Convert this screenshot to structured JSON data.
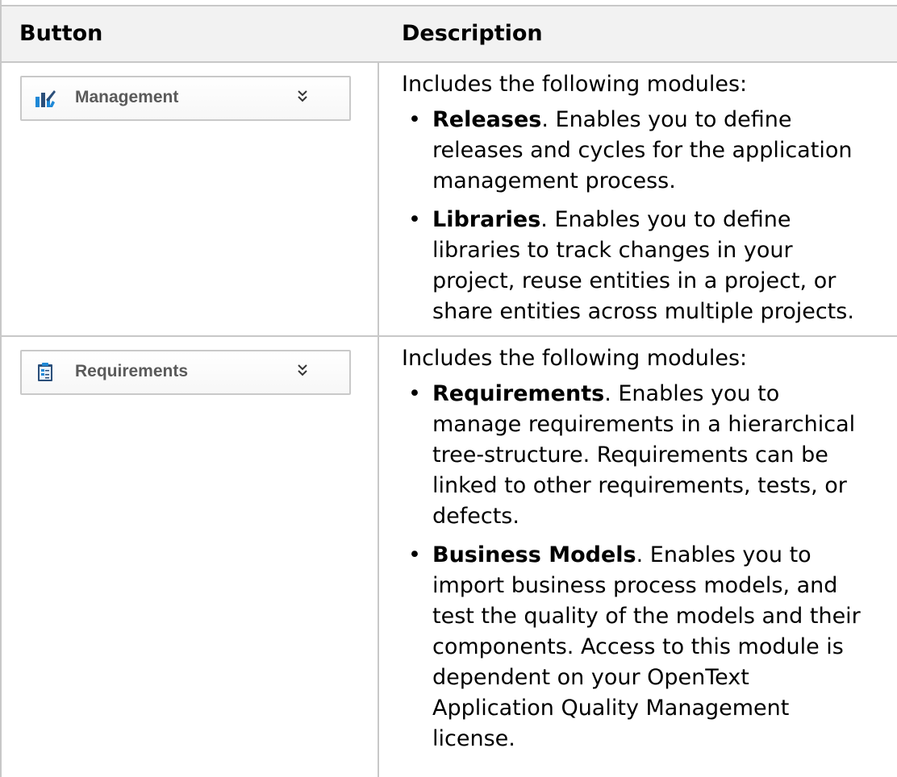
{
  "table": {
    "headers": {
      "button": "Button",
      "description": "Description"
    },
    "rows": [
      {
        "button_label": "Management",
        "button_icon": "management-chart-icon",
        "chevron_icon": "double-chevron-down-icon",
        "intro": "Includes the following modules:",
        "items": [
          {
            "term": "Releases",
            "suffix": ". Enables you to define",
            "lines": [
              "releases and cycles for the application",
              "management process."
            ]
          },
          {
            "term": "Libraries",
            "suffix": ". Enables you to define",
            "lines": [
              "libraries to track changes in your",
              "project, reuse entities in a project, or",
              "share entities across multiple projects."
            ]
          }
        ]
      },
      {
        "button_label": "Requirements",
        "button_icon": "requirements-clipboard-icon",
        "chevron_icon": "double-chevron-down-icon",
        "intro": "Includes the following modules:",
        "items": [
          {
            "term": "Requirements",
            "suffix": ". Enables you to",
            "lines": [
              "manage requirements in a hierarchical",
              "tree-structure. Requirements can be",
              "linked to other requirements, tests, or",
              "defects."
            ]
          },
          {
            "term": "Business Models",
            "suffix": ". Enables you to",
            "lines": [
              "import business process models, and",
              "test the quality of the models and their",
              "components. Access to this module is",
              "dependent on your OpenText",
              "Application Quality Management",
              "license."
            ]
          }
        ]
      }
    ]
  },
  "colors": {
    "border": "#c8c8c8",
    "header_bg": "#f2f2f2",
    "icon_blue": "#1e88d6",
    "icon_dark": "#2b4f7a",
    "button_label": "#5a5a5a"
  }
}
